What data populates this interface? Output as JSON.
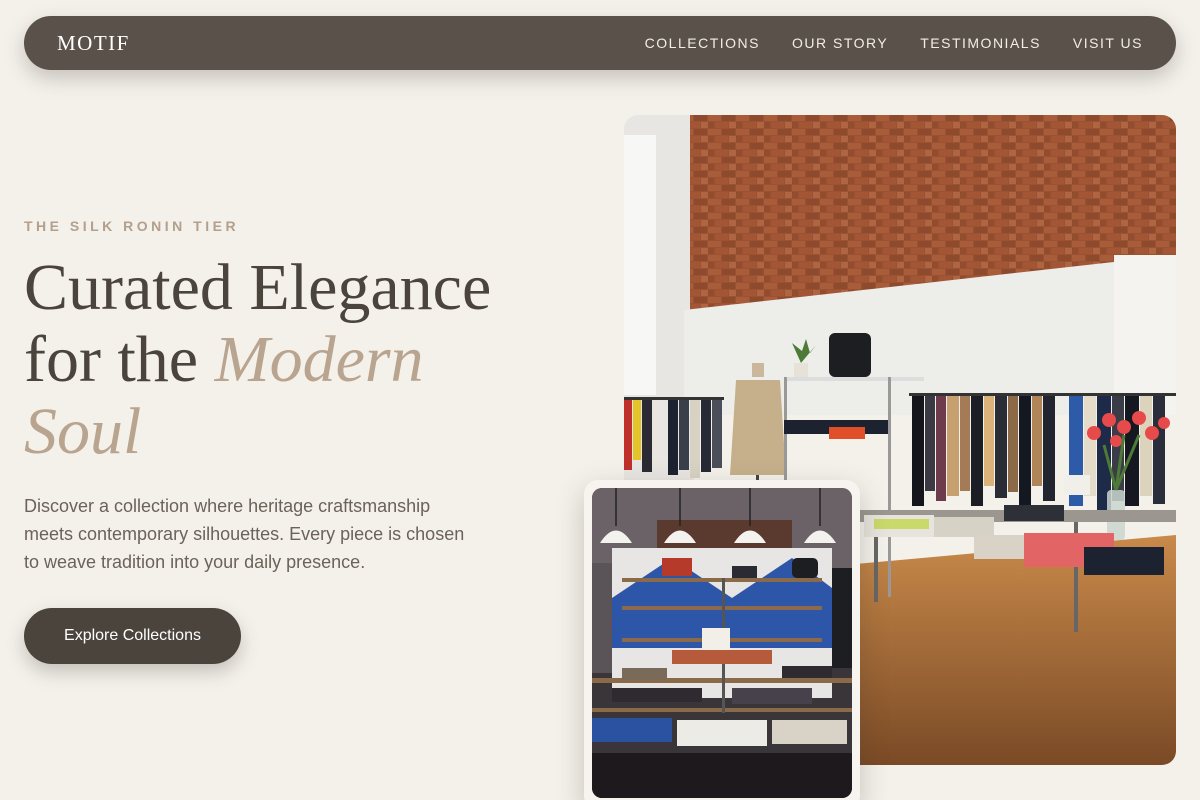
{
  "brand": "MOTIF",
  "nav": {
    "items": [
      "COLLECTIONS",
      "OUR STORY",
      "TESTIMONIALS",
      "VISIT US"
    ]
  },
  "hero": {
    "eyebrow": "THE SILK RONIN TIER",
    "headline_line1": "Curated Elegance",
    "headline_line2_plain": "for the ",
    "headline_line2_accent": "Modern",
    "headline_line3_accent": "Soul",
    "description": "Discover a collection where heritage craftsmanship meets contemporary silhouettes. Every piece is chosen to weave tradition into your daily presence.",
    "cta_label": "Explore Collections"
  },
  "colors": {
    "background": "#f4f1eb",
    "nav_background": "#5a524a",
    "text_dark": "#4a443c",
    "accent": "#b8a48f",
    "eyebrow": "#b3a08c"
  }
}
